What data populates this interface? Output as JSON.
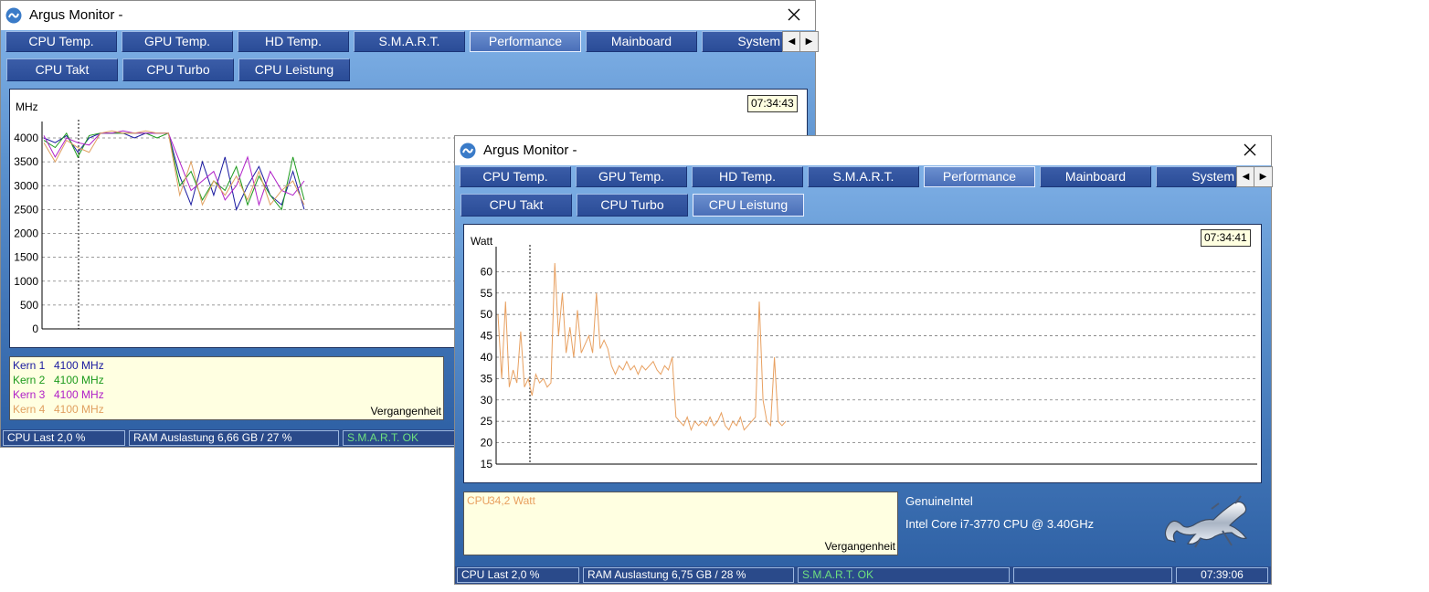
{
  "colors": {
    "core1": "#1a1aa0",
    "core2": "#1c9a1c",
    "core3": "#b020c8",
    "core4": "#e0a060",
    "cpu_power": "#e8a060",
    "status_ok": "#6fe07f"
  },
  "back_window": {
    "title": "Argus Monitor - ",
    "close_icon": "×",
    "tabs": [
      "CPU Temp.",
      "GPU Temp.",
      "HD Temp.",
      "S.M.A.R.T.",
      "Performance",
      "Mainboard",
      "System"
    ],
    "active_tab": "Performance",
    "subtabs": [
      "CPU Takt",
      "CPU Turbo",
      "CPU Leistung"
    ],
    "chart_time": "07:34:43",
    "unit": "MHz",
    "y_ticks": [
      "4000",
      "3500",
      "3000",
      "2500",
      "2000",
      "1500",
      "1000",
      "500",
      "0"
    ],
    "legend": [
      {
        "label": "Kern 1",
        "value": "4100 MHz"
      },
      {
        "label": "Kern 2",
        "value": "4100 MHz"
      },
      {
        "label": "Kern 3",
        "value": "4100 MHz"
      },
      {
        "label": "Kern 4",
        "value": "4100 MHz"
      }
    ],
    "legend_footer": "Vergangenheit",
    "status": {
      "cpu": "CPU Last 2,0 %",
      "ram": "RAM Auslastung 6,66 GB / 27 %",
      "smart": "S.M.A.R.T. OK"
    }
  },
  "front_window": {
    "title": "Argus Monitor - ",
    "close_icon": "×",
    "tabs": [
      "CPU Temp.",
      "GPU Temp.",
      "HD Temp.",
      "S.M.A.R.T.",
      "Performance",
      "Mainboard",
      "System"
    ],
    "active_tab": "Performance",
    "subtabs": [
      "CPU Takt",
      "CPU Turbo",
      "CPU Leistung"
    ],
    "chart_time": "07:34:41",
    "unit": "Watt",
    "y_ticks": [
      "60",
      "55",
      "50",
      "45",
      "40",
      "35",
      "30",
      "25",
      "20",
      "15"
    ],
    "legend": [
      {
        "label": "CPU",
        "value": "34,2 Watt"
      }
    ],
    "legend_footer": "Vergangenheit",
    "cpu_vendor": "GenuineIntel",
    "cpu_model": "Intel Core i7-3770 CPU @ 3.40GHz",
    "status": {
      "cpu": "CPU Last 2,0 %",
      "ram": "RAM Auslastung 6,75 GB / 28 %",
      "smart": "S.M.A.R.T. OK",
      "empty": "",
      "clock": "07:39:06"
    }
  },
  "chart_data": [
    {
      "type": "line",
      "ylabel": "MHz",
      "ylim": [
        0,
        4000
      ],
      "grid": true,
      "series": [
        {
          "name": "Kern 1",
          "values": [
            4000,
            3900,
            4050,
            3700,
            4000,
            4100,
            4100,
            4100,
            4000,
            4100,
            4100,
            4100,
            3200,
            2600,
            3500,
            2800,
            3600,
            2500,
            3000,
            3400,
            2800,
            2600,
            3300,
            2500
          ]
        },
        {
          "name": "Kern 2",
          "values": [
            3950,
            3800,
            4100,
            3600,
            4050,
            4100,
            4100,
            4100,
            4100,
            4100,
            4000,
            4100,
            3000,
            3300,
            2700,
            3100,
            2900,
            3400,
            2600,
            3200,
            2800,
            2500,
            3600,
            2700
          ]
        },
        {
          "name": "Kern 3",
          "values": [
            4050,
            3600,
            4000,
            3900,
            3850,
            4100,
            4100,
            4150,
            4100,
            4100,
            4100,
            4100,
            3500,
            2900,
            3100,
            3300,
            2700,
            3000,
            3600,
            2600,
            3300,
            2900,
            2800,
            3100
          ]
        },
        {
          "name": "Kern 4",
          "values": [
            3900,
            3500,
            3950,
            3800,
            3700,
            4100,
            4150,
            4100,
            4100,
            4150,
            4100,
            4100,
            2800,
            3500,
            2600,
            3100,
            2800,
            3200,
            2700,
            3300,
            2600,
            2900,
            3100,
            2600
          ]
        }
      ]
    },
    {
      "type": "line",
      "ylabel": "Watt",
      "ylim": [
        15,
        62
      ],
      "grid": true,
      "series": [
        {
          "name": "CPU",
          "values": [
            50,
            35,
            53,
            33,
            37,
            34,
            46,
            33,
            35,
            31,
            36,
            34,
            35,
            33,
            34,
            62,
            45,
            55,
            41,
            47,
            40,
            51,
            41,
            43,
            45,
            41,
            55,
            42,
            44,
            42,
            38,
            36,
            38,
            37,
            39,
            37,
            38,
            36,
            38,
            37,
            38,
            39,
            37,
            36,
            38,
            37,
            40,
            26,
            25,
            24,
            26,
            23,
            25,
            24,
            25,
            24,
            26,
            24,
            25,
            27,
            24,
            23,
            25,
            24,
            26,
            23,
            24,
            25,
            26,
            53,
            30,
            25,
            24,
            40,
            25,
            24,
            25
          ]
        }
      ]
    }
  ]
}
